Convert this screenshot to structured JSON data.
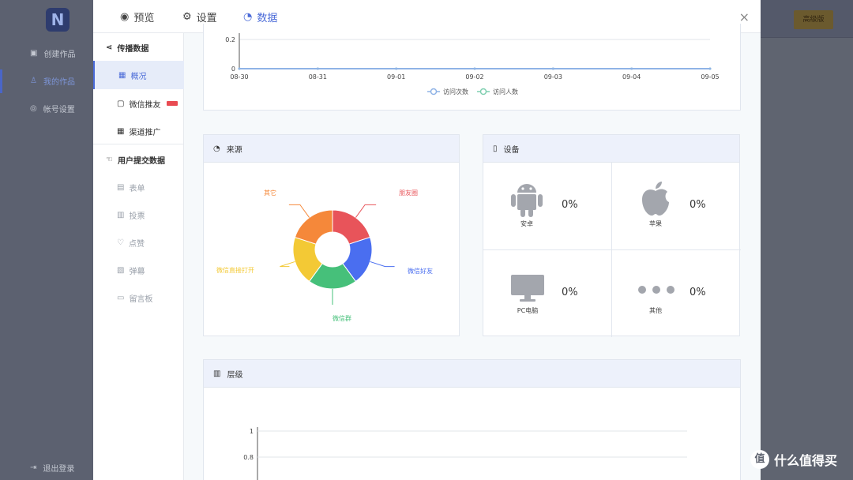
{
  "app": {
    "logo_letter": "N",
    "nav": [
      {
        "label": "创建作品"
      },
      {
        "label": "我的作品"
      },
      {
        "label": "帐号设置"
      }
    ],
    "logout_label": "退出登录",
    "header_button": "高级版"
  },
  "modal": {
    "tabs": [
      {
        "label": "预览",
        "icon": "eye-icon"
      },
      {
        "label": "设置",
        "icon": "gear-icon"
      },
      {
        "label": "数据",
        "icon": "pie-icon",
        "active": true
      }
    ],
    "close_glyph": "×"
  },
  "sidebar": {
    "groups": [
      {
        "label": "传播数据",
        "items": [
          {
            "label": "概况",
            "active": true
          },
          {
            "label": "微信推友",
            "badge": "HOT"
          },
          {
            "label": "渠道推广"
          }
        ]
      },
      {
        "label": "用户提交数据",
        "items": [
          {
            "label": "表单"
          },
          {
            "label": "投票"
          },
          {
            "label": "点赞"
          },
          {
            "label": "弹幕"
          },
          {
            "label": "留言板"
          }
        ]
      }
    ]
  },
  "trend": {
    "legend": [
      "访问次数",
      "访问人数"
    ]
  },
  "source": {
    "title": "来源",
    "labels": [
      "朋友圈",
      "微信好友",
      "微信群",
      "微信直接打开",
      "其它"
    ]
  },
  "device": {
    "title": "设备",
    "items": [
      {
        "name": "安卓",
        "value": "0%",
        "icon": "android-icon"
      },
      {
        "name": "苹果",
        "value": "0%",
        "icon": "apple-icon"
      },
      {
        "name": "PC电脑",
        "value": "0%",
        "icon": "monitor-icon"
      },
      {
        "name": "其他",
        "value": "0%",
        "icon": "more-dots-icon"
      }
    ]
  },
  "level": {
    "title": "层级"
  },
  "watermark": {
    "text": "什么值得买",
    "glyph": "值"
  },
  "colors": {
    "accent": "#4b6bd8",
    "series_1": "#8fb3e6",
    "series_2": "#7fcfb0"
  },
  "chart_data": [
    {
      "type": "line",
      "categories": [
        "08-30",
        "08-31",
        "09-01",
        "09-02",
        "09-03",
        "09-04",
        "09-05"
      ],
      "y_ticks": [
        "0",
        "0.2"
      ],
      "ylim": [
        0,
        0.2
      ],
      "legend_position": "bottom",
      "series": [
        {
          "name": "访问次数",
          "values": [
            0,
            0,
            0,
            0,
            0,
            0,
            0
          ],
          "color": "#8fb3e6"
        },
        {
          "name": "访问人数",
          "values": [
            0,
            0,
            0,
            0,
            0,
            0,
            0
          ],
          "color": "#7fcfb0"
        }
      ]
    },
    {
      "type": "pie",
      "title": "来源",
      "slices": [
        {
          "label": "朋友圈",
          "value": 1,
          "color": "#e8545a"
        },
        {
          "label": "微信好友",
          "value": 1,
          "color": "#4a6ef0"
        },
        {
          "label": "微信群",
          "value": 1,
          "color": "#46c07a"
        },
        {
          "label": "微信直接打开",
          "value": 1,
          "color": "#f3c935"
        },
        {
          "label": "其它",
          "value": 1,
          "color": "#f5883a"
        }
      ]
    },
    {
      "type": "line",
      "title": "层级",
      "y_ticks": [
        "1",
        "0.8"
      ],
      "ylim": [
        0,
        1
      ],
      "series": []
    }
  ]
}
